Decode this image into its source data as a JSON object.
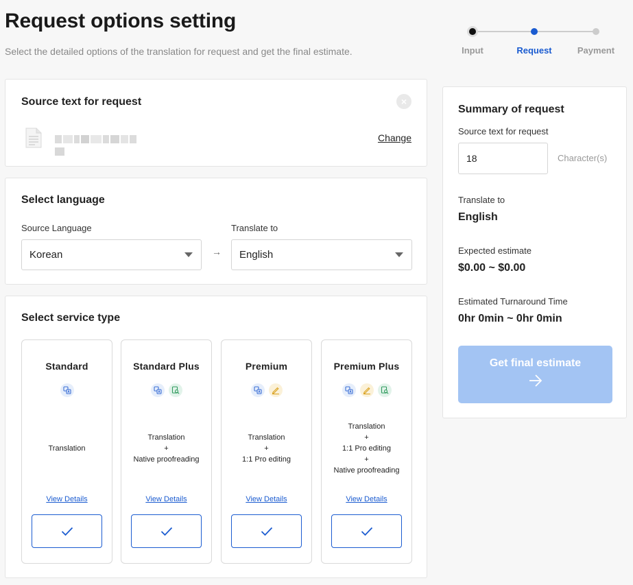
{
  "header": {
    "title": "Request options setting",
    "subtitle": "Select the detailed options of the translation for request and get the final estimate."
  },
  "stepper": {
    "steps": [
      {
        "label": "Input",
        "state": "done"
      },
      {
        "label": "Request",
        "state": "active"
      },
      {
        "label": "Payment",
        "state": "pending"
      }
    ],
    "colors": {
      "done": "#111111",
      "active": "#1a5bd0",
      "pending": "#cccccc"
    }
  },
  "source": {
    "title": "Source text for request",
    "close_icon": "close-icon",
    "file_icon": "document-icon",
    "change_label": "Change"
  },
  "language": {
    "title": "Select language",
    "source_label": "Source Language",
    "source_value": "Korean",
    "target_label": "Translate to",
    "target_value": "English",
    "arrow": "→"
  },
  "service": {
    "title": "Select service type",
    "items": [
      {
        "name": "Standard",
        "desc": [
          "Translation"
        ],
        "link": "View Details",
        "icons": [
          "translate-icon"
        ]
      },
      {
        "name": "Standard Plus",
        "desc": [
          "Translation",
          "+",
          "Native proofreading"
        ],
        "link": "View Details",
        "icons": [
          "translate-icon",
          "proofread-icon"
        ]
      },
      {
        "name": "Premium",
        "desc": [
          "Translation",
          "+",
          "1:1 Pro editing"
        ],
        "link": "View Details",
        "icons": [
          "translate-icon",
          "edit-icon"
        ]
      },
      {
        "name": "Premium Plus",
        "desc": [
          "Translation",
          "+",
          "1:1 Pro editing",
          "+",
          "Native proofreading"
        ],
        "link": "View Details",
        "icons": [
          "translate-icon",
          "edit-icon",
          "proofread-icon"
        ]
      }
    ],
    "accent": "#1a5bd0"
  },
  "summary": {
    "title": "Summary of request",
    "source_label": "Source text for request",
    "char_count": "18",
    "char_unit": "Character(s)",
    "translate_label": "Translate to",
    "translate_value": "English",
    "estimate_label": "Expected estimate",
    "estimate_value": "$0.00 ~ $0.00",
    "turnaround_label": "Estimated Turnaround Time",
    "turnaround_value": "0hr 0min ~ 0hr 0min",
    "cta_label": "Get final estimate",
    "cta_color": "#a3c4f3"
  }
}
